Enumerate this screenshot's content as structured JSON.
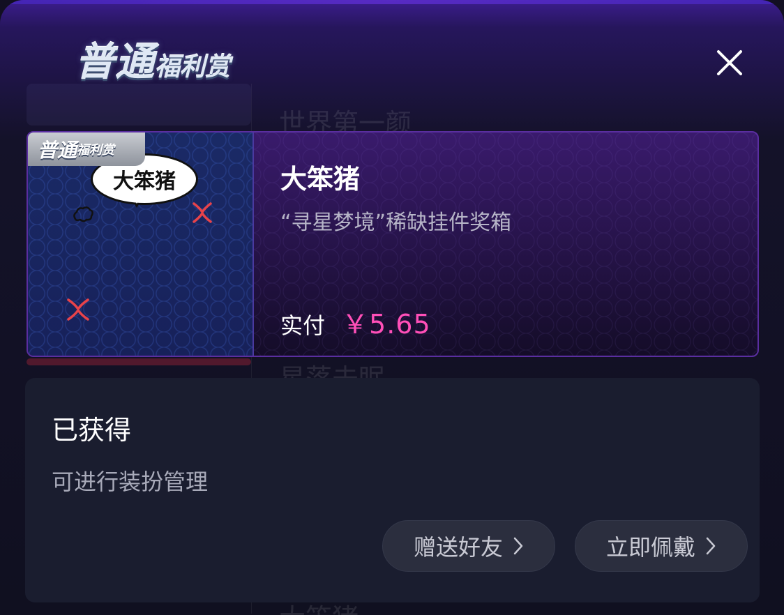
{
  "header": {
    "title_big": "普通",
    "title_small": "福利赏"
  },
  "close": {
    "icon": "close-icon"
  },
  "background_list": {
    "row_1": "世界第一颜",
    "row_2": "星落未眠",
    "row_3": "大笨猪"
  },
  "item": {
    "tag_big": "普通",
    "tag_small": "福利赏",
    "bubble_text": "大笨猪",
    "name": "大笨猪",
    "description": "“寻星梦境”稀缺挂件奖箱",
    "price_label": "实付",
    "price_value": "￥5.65"
  },
  "status": {
    "title": "已获得",
    "subtitle": "可进行装扮管理",
    "gift_button": "赠送好友",
    "wear_button": "立即佩戴"
  },
  "colors": {
    "accent_price": "#ff4fb8",
    "panel_bg": "#1a1d2f",
    "card_border": "#5a2ea0"
  }
}
